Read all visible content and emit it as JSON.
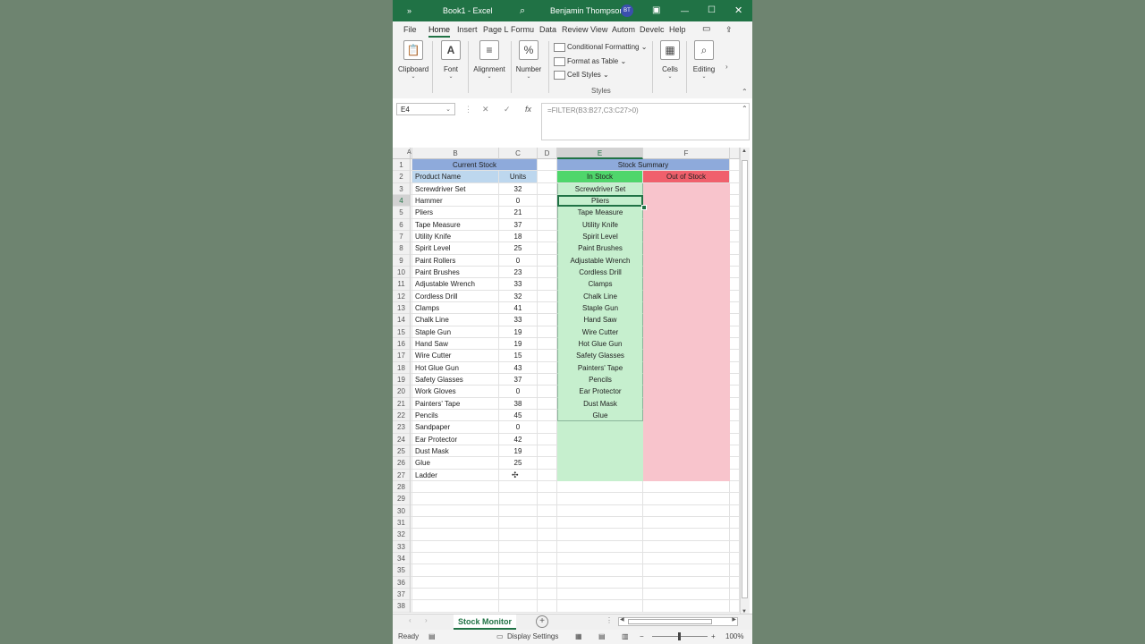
{
  "titlebar": {
    "qat": "»",
    "doc_title": "Book1 - Excel",
    "user_name": "Benjamin Thompson",
    "user_initials": "BT",
    "colors": {
      "title_bg": "#207245"
    }
  },
  "menu": [
    "File",
    "Home",
    "Insert",
    "Page L",
    "Formu",
    "Data",
    "Review",
    "View",
    "Autom",
    "Develc",
    "Help"
  ],
  "ribbon": {
    "clipboard": "Clipboard",
    "font": "Font",
    "alignment": "Alignment",
    "number": "Number",
    "conditional_formatting": "Conditional Formatting",
    "format_as_table": "Format as Table",
    "cell_styles": "Cell Styles",
    "styles_group": "Styles",
    "cells": "Cells",
    "editing": "Editing"
  },
  "formula_bar": {
    "name_box": "E4",
    "cancel": "✕",
    "enter": "✓",
    "fx": "fx",
    "formula": "=FILTER(B3:B27,C3:C27>0)"
  },
  "columns": [
    "A",
    "B",
    "C",
    "D",
    "E",
    "F"
  ],
  "rows": [
    "1",
    "2",
    "3",
    "4",
    "5",
    "6",
    "7",
    "8",
    "9",
    "10",
    "11",
    "12",
    "13",
    "14",
    "15",
    "16",
    "17",
    "18",
    "19",
    "20",
    "21",
    "22",
    "23",
    "24",
    "25",
    "26",
    "27",
    "28",
    "29",
    "30",
    "31",
    "32",
    "33",
    "34",
    "35",
    "36",
    "37",
    "38"
  ],
  "current_stock": {
    "title": "Current Stock",
    "col_product": "Product Name",
    "col_units": "Units",
    "items": [
      {
        "name": "Screwdriver Set",
        "units": "32"
      },
      {
        "name": "Hammer",
        "units": "0"
      },
      {
        "name": "Pliers",
        "units": "21"
      },
      {
        "name": "Tape Measure",
        "units": "37"
      },
      {
        "name": "Utility Knife",
        "units": "18"
      },
      {
        "name": "Spirit Level",
        "units": "25"
      },
      {
        "name": "Paint Rollers",
        "units": "0"
      },
      {
        "name": "Paint Brushes",
        "units": "23"
      },
      {
        "name": "Adjustable Wrench",
        "units": "33"
      },
      {
        "name": "Cordless Drill",
        "units": "32"
      },
      {
        "name": "Clamps",
        "units": "41"
      },
      {
        "name": "Chalk Line",
        "units": "33"
      },
      {
        "name": "Staple Gun",
        "units": "19"
      },
      {
        "name": "Hand Saw",
        "units": "19"
      },
      {
        "name": "Wire Cutter",
        "units": "15"
      },
      {
        "name": "Hot Glue Gun",
        "units": "43"
      },
      {
        "name": "Safety Glasses",
        "units": "37"
      },
      {
        "name": "Work Gloves",
        "units": "0"
      },
      {
        "name": "Painters' Tape",
        "units": "38"
      },
      {
        "name": "Pencils",
        "units": "45"
      },
      {
        "name": "Sandpaper",
        "units": "0"
      },
      {
        "name": "Ear Protector",
        "units": "42"
      },
      {
        "name": "Dust Mask",
        "units": "19"
      },
      {
        "name": "Glue",
        "units": "25"
      },
      {
        "name": "Ladder",
        "units": ""
      }
    ]
  },
  "stock_summary": {
    "title": "Stock Summary",
    "in_stock_header": "In Stock",
    "out_of_stock_header": "Out of Stock",
    "in_stock": [
      "Screwdriver Set",
      "Pliers",
      "Tape Measure",
      "Utility Knife",
      "Spirit Level",
      "Paint Brushes",
      "Adjustable Wrench",
      "Cordless Drill",
      "Clamps",
      "Chalk Line",
      "Staple Gun",
      "Hand Saw",
      "Wire Cutter",
      "Hot Glue Gun",
      "Safety Glasses",
      "Painters' Tape",
      "Pencils",
      "Ear Protector",
      "Dust Mask",
      "Glue"
    ]
  },
  "colors": {
    "header_blue": "#8eaadb",
    "subheader_blue": "#bdd7ee",
    "in_stock_header": "#4fd66b",
    "in_stock_fill": "#c6efce",
    "out_header": "#f0606c",
    "out_fill": "#f8c4cc",
    "excel_green": "#207245"
  },
  "sheet_tabs": {
    "active": "Stock Monitor",
    "add": "+"
  },
  "status": {
    "ready": "Ready",
    "display_settings": "Display Settings",
    "zoom": "100%"
  }
}
